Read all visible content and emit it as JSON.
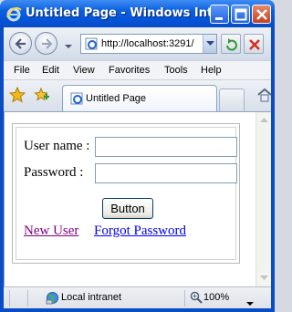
{
  "window": {
    "title": "Untitled Page - Windows Inte...",
    "minimize_icon": "minimize-icon",
    "maximize_icon": "maximize-icon",
    "close_icon": "close-icon"
  },
  "navbar": {
    "back_icon": "back-arrow-icon",
    "forward_icon": "forward-arrow-icon",
    "address_url": "http://localhost:3291/",
    "refresh_icon": "refresh-icon",
    "stop_icon": "stop-icon"
  },
  "menubar": {
    "items": [
      "File",
      "Edit",
      "View",
      "Favorites",
      "Tools",
      "Help"
    ]
  },
  "tabs": {
    "active_label": "Untitled Page"
  },
  "form": {
    "username_label": "User name :",
    "username_value": "",
    "password_label": "Password :",
    "password_value": "",
    "submit_label": "Button",
    "new_user_link": "New User",
    "forgot_password_link": "Forgot Password"
  },
  "status": {
    "zone": "Local intranet",
    "zoom": "100%"
  },
  "colors": {
    "titlebar": "#0553d6",
    "visited_link": "#800080",
    "link": "#0000ee"
  }
}
